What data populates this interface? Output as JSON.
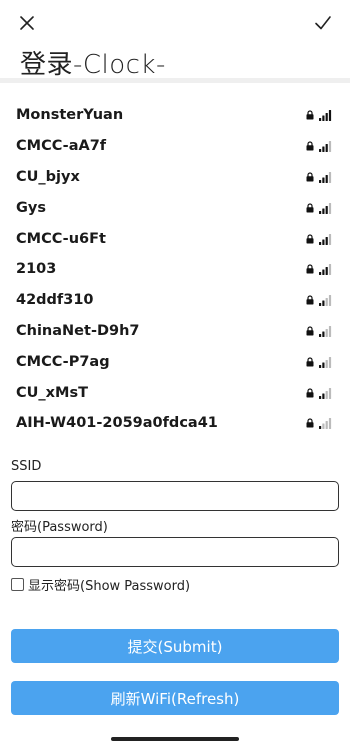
{
  "header": {
    "title": "登录-Clock-",
    "close_icon": "close-icon",
    "confirm_icon": "check-icon"
  },
  "wifi_networks": [
    {
      "ssid": "MonsterYuan",
      "secured": true,
      "signal_bars": 4
    },
    {
      "ssid": "CMCC-aA7f",
      "secured": true,
      "signal_bars": 3
    },
    {
      "ssid": "CU_bjyx",
      "secured": true,
      "signal_bars": 3
    },
    {
      "ssid": "Gys",
      "secured": true,
      "signal_bars": 3
    },
    {
      "ssid": "CMCC-u6Ft",
      "secured": true,
      "signal_bars": 3
    },
    {
      "ssid": "2103",
      "secured": true,
      "signal_bars": 3
    },
    {
      "ssid": "42ddf310",
      "secured": true,
      "signal_bars": 2
    },
    {
      "ssid": "ChinaNet-D9h7",
      "secured": true,
      "signal_bars": 2
    },
    {
      "ssid": "CMCC-P7ag",
      "secured": true,
      "signal_bars": 2
    },
    {
      "ssid": "CU_xMsT",
      "secured": true,
      "signal_bars": 2
    },
    {
      "ssid": "AIH-W401-2059a0fdca41",
      "secured": true,
      "signal_bars": 1
    }
  ],
  "form": {
    "ssid_label": "SSID",
    "ssid_value": "",
    "password_label": "密码(Password)",
    "password_value": "",
    "show_password_label": "显示密码(Show Password)",
    "show_password_checked": false
  },
  "buttons": {
    "submit_label": "提交(Submit)",
    "refresh_label": "刷新WiFi(Refresh)"
  },
  "colors": {
    "button_bg": "#4ba3ef",
    "signal_active": "#111111",
    "signal_inactive": "#bbbbbb"
  }
}
